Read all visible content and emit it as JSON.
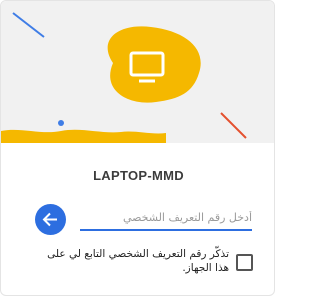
{
  "device": {
    "name": "LAPTOP-MMD"
  },
  "pin_input": {
    "value": "",
    "placeholder": "أدخل رقم التعريف الشخصي"
  },
  "remember": {
    "label": "تذكّر رقم التعريف الشخصي التابع لي على هذا الجهاز.",
    "checked": false
  },
  "icons": {
    "banner": "monitor-icon",
    "back": "arrow-left-icon"
  },
  "colors": {
    "accent": "#2d6ee0",
    "blob": "#f5b800",
    "banner_bg": "#f1f1f1",
    "line_blue": "#3f7de6",
    "line_red": "#e4512f"
  }
}
